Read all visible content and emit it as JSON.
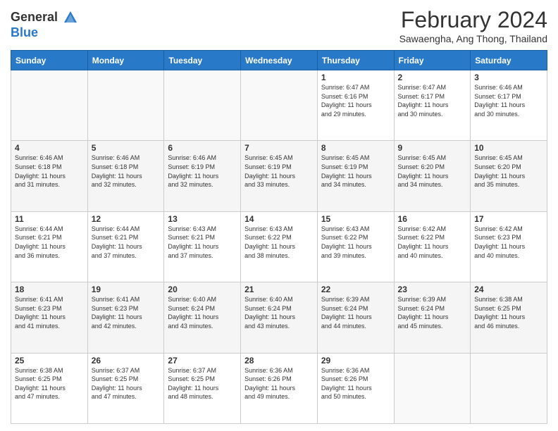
{
  "header": {
    "logo_general": "General",
    "logo_blue": "Blue",
    "month_year": "February 2024",
    "location": "Sawaengha, Ang Thong, Thailand"
  },
  "weekdays": [
    "Sunday",
    "Monday",
    "Tuesday",
    "Wednesday",
    "Thursday",
    "Friday",
    "Saturday"
  ],
  "weeks": [
    [
      {
        "day": "",
        "info": ""
      },
      {
        "day": "",
        "info": ""
      },
      {
        "day": "",
        "info": ""
      },
      {
        "day": "",
        "info": ""
      },
      {
        "day": "1",
        "info": "Sunrise: 6:47 AM\nSunset: 6:16 PM\nDaylight: 11 hours\nand 29 minutes."
      },
      {
        "day": "2",
        "info": "Sunrise: 6:47 AM\nSunset: 6:17 PM\nDaylight: 11 hours\nand 30 minutes."
      },
      {
        "day": "3",
        "info": "Sunrise: 6:46 AM\nSunset: 6:17 PM\nDaylight: 11 hours\nand 30 minutes."
      }
    ],
    [
      {
        "day": "4",
        "info": "Sunrise: 6:46 AM\nSunset: 6:18 PM\nDaylight: 11 hours\nand 31 minutes."
      },
      {
        "day": "5",
        "info": "Sunrise: 6:46 AM\nSunset: 6:18 PM\nDaylight: 11 hours\nand 32 minutes."
      },
      {
        "day": "6",
        "info": "Sunrise: 6:46 AM\nSunset: 6:19 PM\nDaylight: 11 hours\nand 32 minutes."
      },
      {
        "day": "7",
        "info": "Sunrise: 6:45 AM\nSunset: 6:19 PM\nDaylight: 11 hours\nand 33 minutes."
      },
      {
        "day": "8",
        "info": "Sunrise: 6:45 AM\nSunset: 6:19 PM\nDaylight: 11 hours\nand 34 minutes."
      },
      {
        "day": "9",
        "info": "Sunrise: 6:45 AM\nSunset: 6:20 PM\nDaylight: 11 hours\nand 34 minutes."
      },
      {
        "day": "10",
        "info": "Sunrise: 6:45 AM\nSunset: 6:20 PM\nDaylight: 11 hours\nand 35 minutes."
      }
    ],
    [
      {
        "day": "11",
        "info": "Sunrise: 6:44 AM\nSunset: 6:21 PM\nDaylight: 11 hours\nand 36 minutes."
      },
      {
        "day": "12",
        "info": "Sunrise: 6:44 AM\nSunset: 6:21 PM\nDaylight: 11 hours\nand 37 minutes."
      },
      {
        "day": "13",
        "info": "Sunrise: 6:43 AM\nSunset: 6:21 PM\nDaylight: 11 hours\nand 37 minutes."
      },
      {
        "day": "14",
        "info": "Sunrise: 6:43 AM\nSunset: 6:22 PM\nDaylight: 11 hours\nand 38 minutes."
      },
      {
        "day": "15",
        "info": "Sunrise: 6:43 AM\nSunset: 6:22 PM\nDaylight: 11 hours\nand 39 minutes."
      },
      {
        "day": "16",
        "info": "Sunrise: 6:42 AM\nSunset: 6:22 PM\nDaylight: 11 hours\nand 40 minutes."
      },
      {
        "day": "17",
        "info": "Sunrise: 6:42 AM\nSunset: 6:23 PM\nDaylight: 11 hours\nand 40 minutes."
      }
    ],
    [
      {
        "day": "18",
        "info": "Sunrise: 6:41 AM\nSunset: 6:23 PM\nDaylight: 11 hours\nand 41 minutes."
      },
      {
        "day": "19",
        "info": "Sunrise: 6:41 AM\nSunset: 6:23 PM\nDaylight: 11 hours\nand 42 minutes."
      },
      {
        "day": "20",
        "info": "Sunrise: 6:40 AM\nSunset: 6:24 PM\nDaylight: 11 hours\nand 43 minutes."
      },
      {
        "day": "21",
        "info": "Sunrise: 6:40 AM\nSunset: 6:24 PM\nDaylight: 11 hours\nand 43 minutes."
      },
      {
        "day": "22",
        "info": "Sunrise: 6:39 AM\nSunset: 6:24 PM\nDaylight: 11 hours\nand 44 minutes."
      },
      {
        "day": "23",
        "info": "Sunrise: 6:39 AM\nSunset: 6:24 PM\nDaylight: 11 hours\nand 45 minutes."
      },
      {
        "day": "24",
        "info": "Sunrise: 6:38 AM\nSunset: 6:25 PM\nDaylight: 11 hours\nand 46 minutes."
      }
    ],
    [
      {
        "day": "25",
        "info": "Sunrise: 6:38 AM\nSunset: 6:25 PM\nDaylight: 11 hours\nand 47 minutes."
      },
      {
        "day": "26",
        "info": "Sunrise: 6:37 AM\nSunset: 6:25 PM\nDaylight: 11 hours\nand 47 minutes."
      },
      {
        "day": "27",
        "info": "Sunrise: 6:37 AM\nSunset: 6:25 PM\nDaylight: 11 hours\nand 48 minutes."
      },
      {
        "day": "28",
        "info": "Sunrise: 6:36 AM\nSunset: 6:26 PM\nDaylight: 11 hours\nand 49 minutes."
      },
      {
        "day": "29",
        "info": "Sunrise: 6:36 AM\nSunset: 6:26 PM\nDaylight: 11 hours\nand 50 minutes."
      },
      {
        "day": "",
        "info": ""
      },
      {
        "day": "",
        "info": ""
      }
    ]
  ]
}
